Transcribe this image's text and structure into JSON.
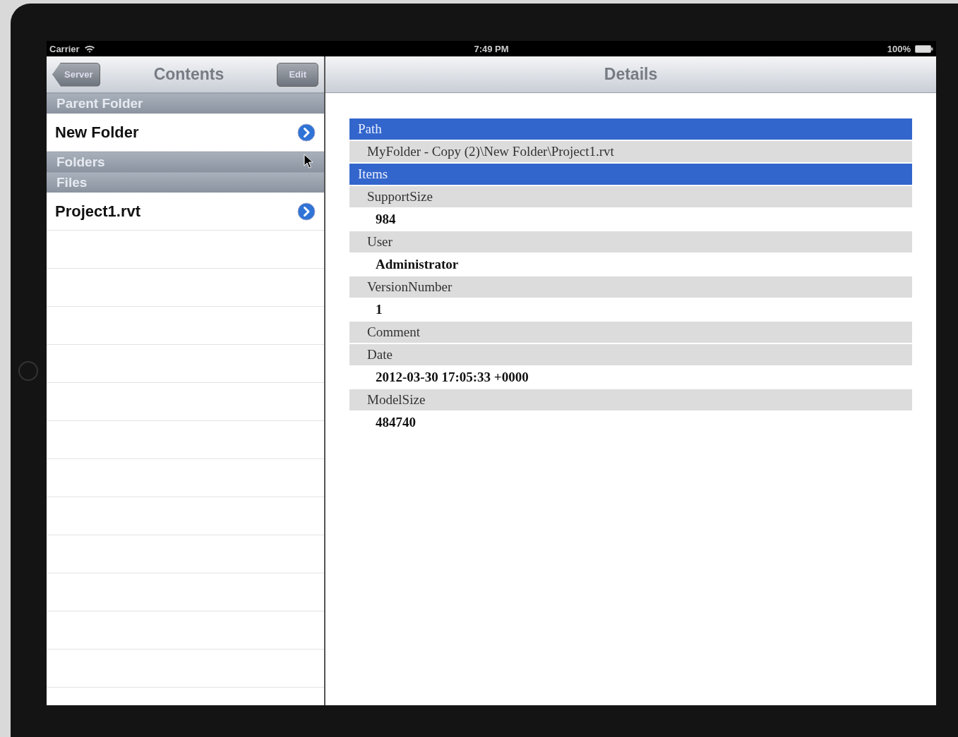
{
  "status_bar": {
    "carrier": "Carrier",
    "time": "7:49 PM",
    "battery": "100%"
  },
  "master": {
    "back_button": "Server",
    "title": "Contents",
    "edit_button": "Edit",
    "sections": [
      {
        "header": "Parent Folder",
        "rows": [
          {
            "label": "New Folder"
          }
        ]
      },
      {
        "header": "Folders"
      },
      {
        "header": "Files",
        "rows": [
          {
            "label": "Project1.rvt"
          }
        ]
      }
    ]
  },
  "detail": {
    "title": "Details",
    "rows": [
      {
        "kind": "header",
        "text": "Path"
      },
      {
        "kind": "label",
        "text": "MyFolder - Copy (2)\\New Folder\\Project1.rvt"
      },
      {
        "kind": "header",
        "text": "Items"
      },
      {
        "kind": "label",
        "text": "SupportSize"
      },
      {
        "kind": "value",
        "text": "984"
      },
      {
        "kind": "label",
        "text": "User"
      },
      {
        "kind": "value",
        "text": "Administrator"
      },
      {
        "kind": "label",
        "text": "VersionNumber"
      },
      {
        "kind": "value",
        "text": "1"
      },
      {
        "kind": "label",
        "text": "Comment"
      },
      {
        "kind": "label",
        "text": "Date"
      },
      {
        "kind": "value",
        "text": "2012-03-30 17:05:33 +0000"
      },
      {
        "kind": "label",
        "text": "ModelSize"
      },
      {
        "kind": "value",
        "text": "484740"
      }
    ]
  }
}
